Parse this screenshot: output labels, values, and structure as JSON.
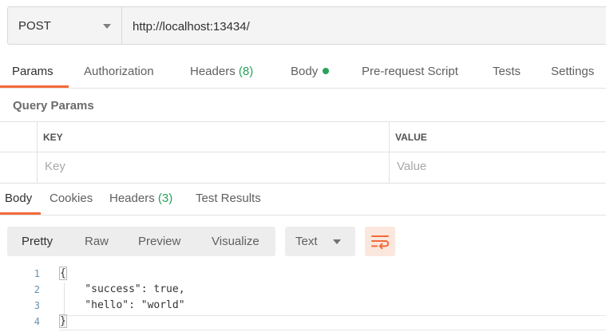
{
  "request": {
    "method": "POST",
    "url": "http://localhost:13434/"
  },
  "request_tabs": [
    {
      "label": "Params",
      "active": true
    },
    {
      "label": "Authorization"
    },
    {
      "label": "Headers",
      "count": "(8)"
    },
    {
      "label": "Body",
      "indicator": "green-dot"
    },
    {
      "label": "Pre-request Script"
    },
    {
      "label": "Tests"
    },
    {
      "label": "Settings"
    }
  ],
  "query_params": {
    "title": "Query Params",
    "columns": {
      "key": "KEY",
      "value": "VALUE"
    },
    "placeholders": {
      "key": "Key",
      "value": "Value"
    }
  },
  "response_tabs": [
    {
      "label": "Body",
      "active": true
    },
    {
      "label": "Cookies"
    },
    {
      "label": "Headers",
      "count": "(3)"
    },
    {
      "label": "Test Results"
    }
  ],
  "view_modes": [
    "Pretty",
    "Raw",
    "Preview",
    "Visualize"
  ],
  "active_view_mode": "Pretty",
  "format": "Text",
  "wrap_icon": "wrap-lines-icon",
  "code": {
    "line_numbers": [
      "1",
      "2",
      "3",
      "4"
    ],
    "lines": [
      "{",
      "    \"success\": true,",
      "    \"hello\": \"world\"",
      "}"
    ]
  },
  "colors": {
    "accent": "#f26b3a",
    "count_green": "#26a35b"
  }
}
